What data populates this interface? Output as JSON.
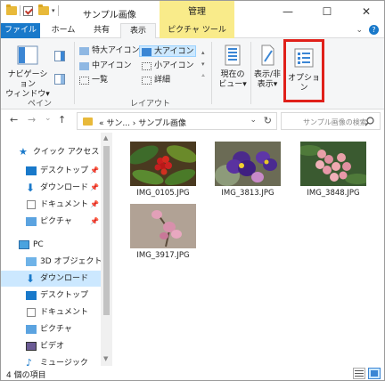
{
  "window": {
    "title": "サンプル画像",
    "context_tab": "管理",
    "minimize": "—",
    "maximize": "☐",
    "close": "✕"
  },
  "tabs": [
    {
      "label": "ファイル"
    },
    {
      "label": "ホーム"
    },
    {
      "label": "共有"
    },
    {
      "label": "表示"
    },
    {
      "label": "ピクチャ ツール"
    }
  ],
  "ribbon": {
    "pane_group": {
      "nav_pane_label": "ナビゲーション",
      "nav_pane_label2": "ウィンドウ▾",
      "group_label": "ペイン"
    },
    "layout_group": {
      "options": [
        {
          "label": "特大アイコン"
        },
        {
          "label": "大アイコン"
        },
        {
          "label": "中アイコン"
        },
        {
          "label": "小アイコン"
        },
        {
          "label": "一覧"
        },
        {
          "label": "詳細"
        }
      ],
      "selected": "大アイコン",
      "group_label": "レイアウト"
    },
    "current_view": {
      "line1": "現在の",
      "line2": "ビュー▾"
    },
    "show_hide": {
      "line1": "表示/非",
      "line2": "表示▾"
    },
    "options": {
      "label": "オプション"
    },
    "highlight_color": "#e0201a"
  },
  "navbar": {
    "back": "←",
    "forward": "→",
    "recent": "⌄",
    "up": "↑",
    "address": "«  サン...  ›  サンプル画像",
    "address_dropdown": "⌄",
    "refresh": "↻",
    "search_placeholder": "サンプル画像の検索"
  },
  "navpane": {
    "items": [
      {
        "label": "クイック アクセス"
      },
      {
        "label": "デスクトップ"
      },
      {
        "label": "ダウンロード"
      },
      {
        "label": "ドキュメント"
      },
      {
        "label": "ピクチャ"
      },
      {
        "label": "PC"
      },
      {
        "label": "3D オブジェクト"
      },
      {
        "label": "ダウンロード"
      },
      {
        "label": "デスクトップ"
      },
      {
        "label": "ドキュメント"
      },
      {
        "label": "ピクチャ"
      },
      {
        "label": "ビデオ"
      },
      {
        "label": "ミュージック"
      }
    ],
    "selected_index": 7
  },
  "files": [
    {
      "name": "IMG_0105.JPG"
    },
    {
      "name": "IMG_3813.JPG"
    },
    {
      "name": "IMG_3848.JPG"
    },
    {
      "name": "IMG_3917.JPG"
    }
  ],
  "status": {
    "count": "4 個の項目"
  }
}
